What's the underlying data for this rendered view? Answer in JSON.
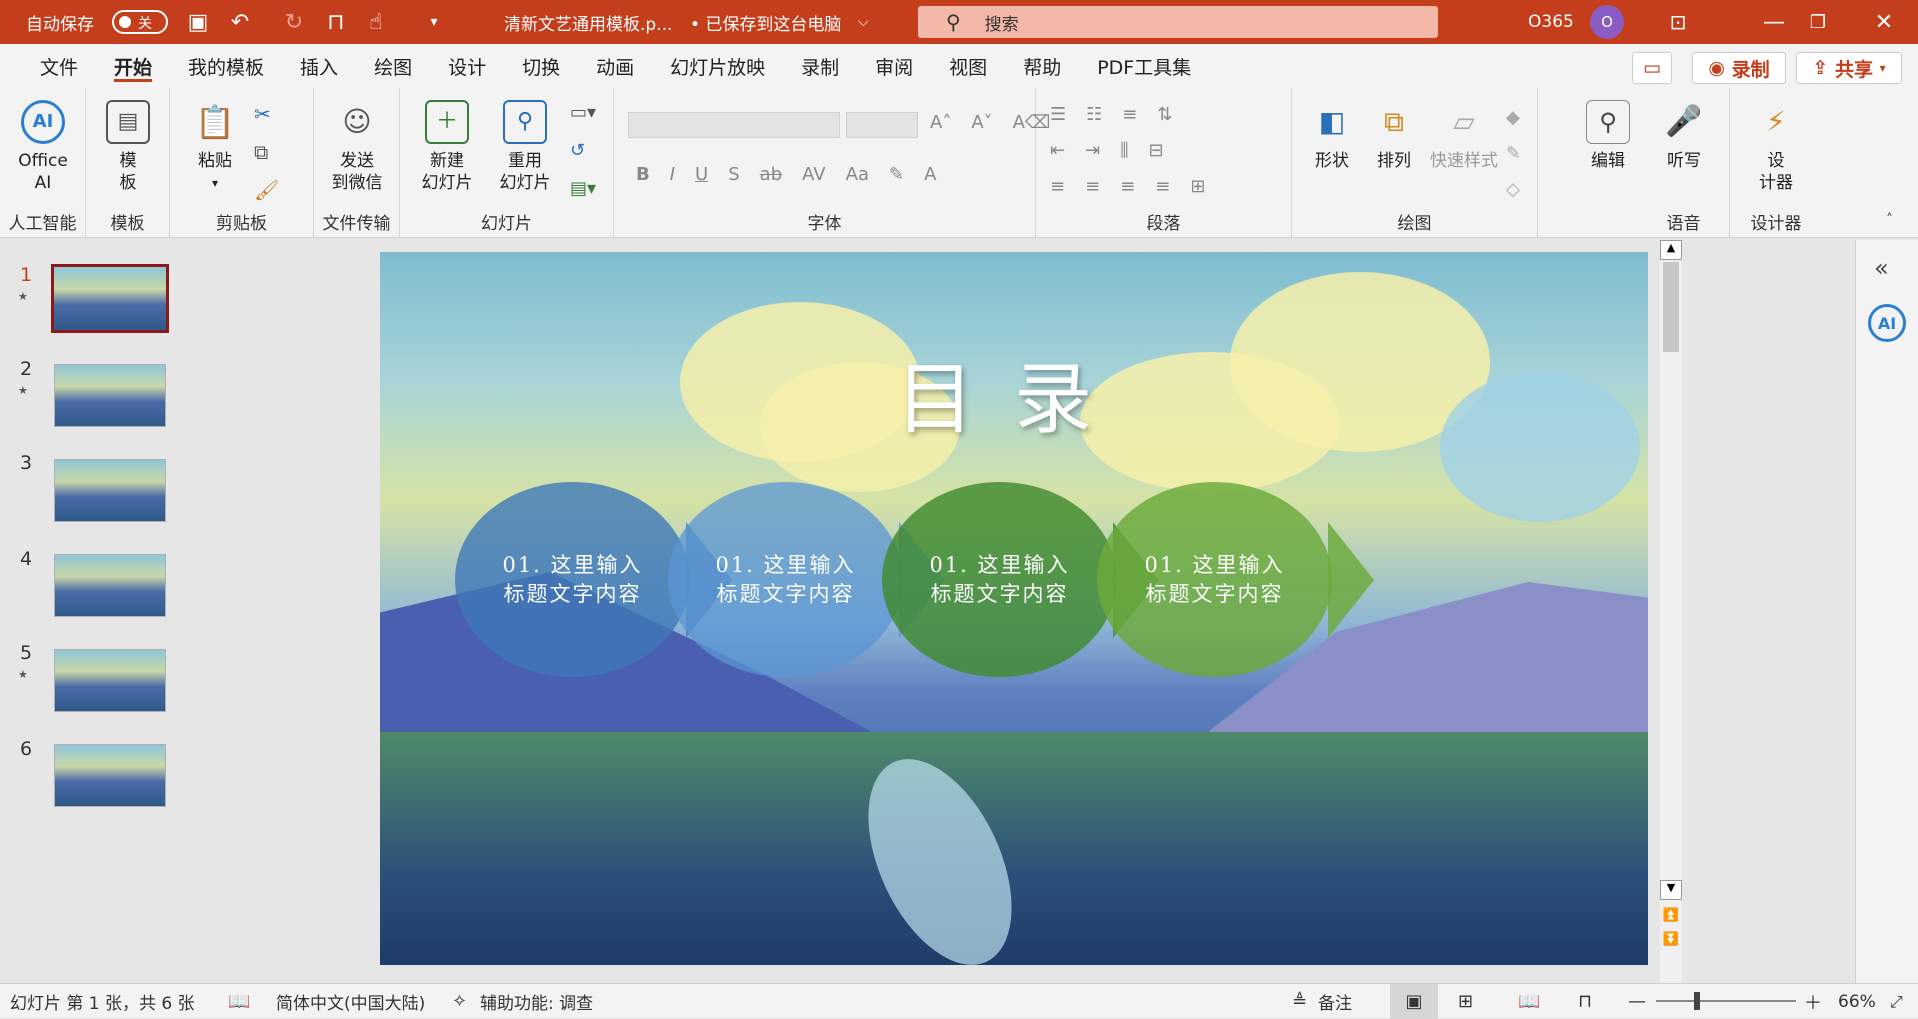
{
  "titlebar": {
    "autosave_label": "自动保存",
    "autosave_state": "关",
    "doc_title": "清新文艺通用模板.p...",
    "save_status": "• 已保存到这台电脑",
    "search_placeholder": "搜索",
    "account": "O365",
    "avatar_initial": "O"
  },
  "menu": {
    "tabs": [
      "文件",
      "开始",
      "我的模板",
      "插入",
      "绘图",
      "设计",
      "切换",
      "动画",
      "幻灯片放映",
      "录制",
      "审阅",
      "视图",
      "帮助",
      "PDF工具集"
    ],
    "active": "开始",
    "record_label": "录制",
    "share_label": "共享"
  },
  "ribbon": {
    "office_ai": [
      "Office",
      "AI"
    ],
    "template_btn": [
      "模",
      "板"
    ],
    "paste_label": "粘贴",
    "send_wechat": [
      "发送",
      "到微信"
    ],
    "new_slide": [
      "新建",
      "幻灯片"
    ],
    "reuse_slide": [
      "重用",
      "幻灯片"
    ],
    "shape_label": "形状",
    "arrange_label": "排列",
    "quick_style_label": "快速样式",
    "edit_label": "编辑",
    "dictate_label": "听写",
    "designer_label": [
      "设",
      "计器"
    ],
    "groups": {
      "ai": "人工智能",
      "template": "模板",
      "clipboard": "剪贴板",
      "file_transfer": "文件传输",
      "slides": "幻灯片",
      "font": "字体",
      "paragraph": "段落",
      "drawing": "绘图",
      "voice": "语音",
      "designer": "设计器"
    }
  },
  "slides": [
    {
      "num": "1",
      "star": true
    },
    {
      "num": "2",
      "star": true
    },
    {
      "num": "3",
      "star": false
    },
    {
      "num": "4",
      "star": false
    },
    {
      "num": "5",
      "star": true
    },
    {
      "num": "6",
      "star": false
    }
  ],
  "slide": {
    "title": "目录",
    "items": [
      {
        "line1": "01. 这里输入",
        "line2": "标题文字内容",
        "color": "#3f78b8"
      },
      {
        "line1": "01. 这里输入",
        "line2": "标题文字内容",
        "color": "#5b95d4"
      },
      {
        "line1": "01. 这里输入",
        "line2": "标题文字内容",
        "color": "#3f8a2e"
      },
      {
        "line1": "01. 这里输入",
        "line2": "标题文字内容",
        "color": "#6aaa3a"
      }
    ]
  },
  "status": {
    "slide_info": "幻灯片 第 1 张，共 6 张",
    "language": "简体中文(中国大陆)",
    "accessibility": "辅助功能: 调查",
    "notes": "备注",
    "zoom": "66%"
  }
}
